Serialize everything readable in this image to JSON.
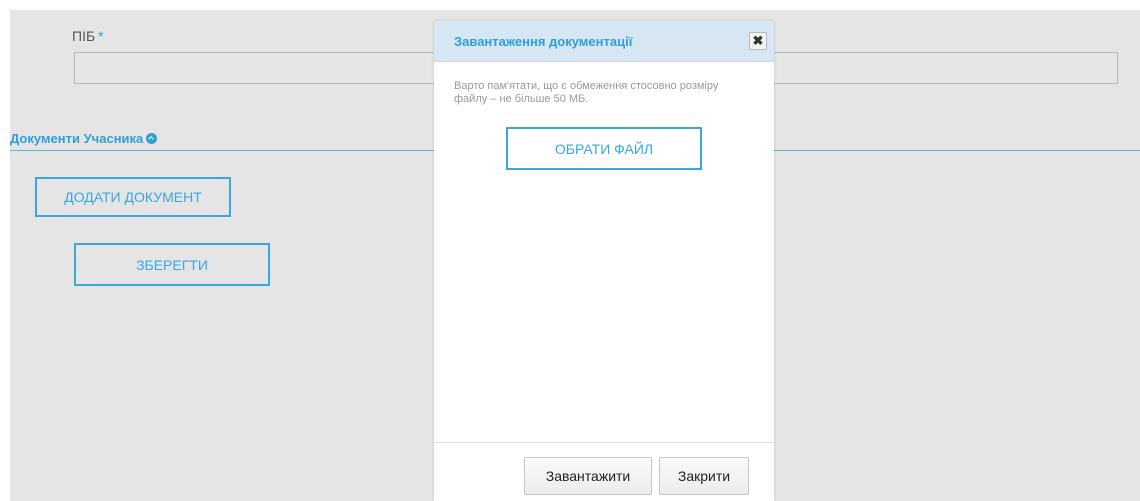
{
  "form": {
    "name_label": "ПІБ",
    "required_mark": "*",
    "name_value": "",
    "section_title": "Документи Учасника",
    "section_icon": "chevron-up-circle-icon",
    "add_document_label": "Додати документ",
    "save_label": "Зберегти"
  },
  "modal": {
    "title": "Завантаження документації",
    "close_symbol": "✖",
    "note": "Варто пам'ятати, що є обмеження стосовно розміру файлу – не більше 50 МБ.",
    "choose_file_label": "Обрати файл",
    "upload_label": "Завантажити",
    "close_label": "Закрити"
  },
  "colors": {
    "accent": "#2f9fd8",
    "background": "#e5e5e5",
    "modal_header": "#d6e6f2"
  }
}
